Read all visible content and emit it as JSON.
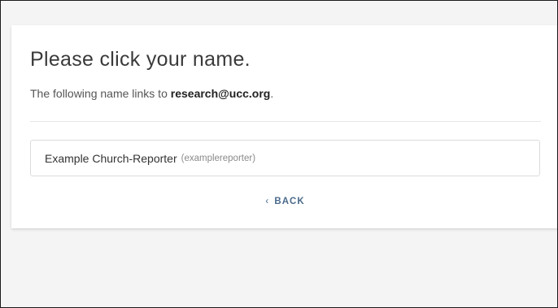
{
  "card": {
    "title": "Please click your name.",
    "subtitle_prefix": "The following name links to ",
    "email": "research@ucc.org",
    "subtitle_suffix": "."
  },
  "names": [
    {
      "full_name": "Example Church-Reporter",
      "username": "(examplereporter)"
    }
  ],
  "back": {
    "icon": "‹",
    "label": "BACK"
  }
}
